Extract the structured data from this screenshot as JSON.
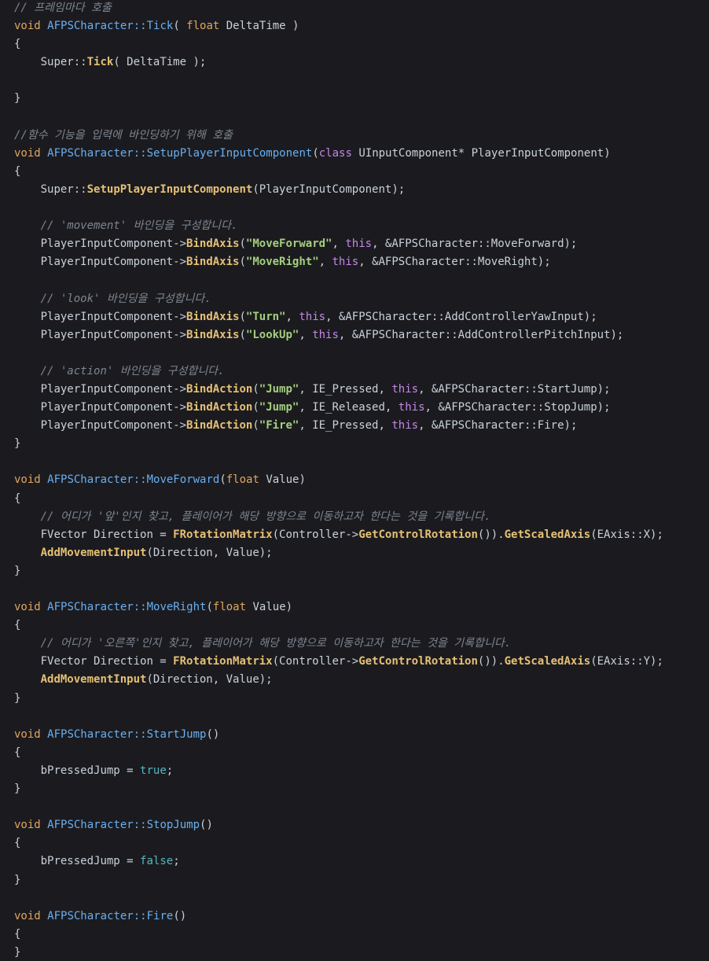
{
  "window": {
    "title": ""
  },
  "colors": {
    "background": "#1b1b1f",
    "comment": "#7d8590",
    "keyword": "#e2a55f",
    "function_def": "#69aff2",
    "function_call": "#e5c075",
    "string": "#a4cf7e",
    "this": "#c586e8",
    "literal": "#56b6c2",
    "text": "#c9d1d9"
  },
  "code": {
    "lines": [
      {
        "indent": 0,
        "tokens": [
          {
            "t": "comment",
            "v": "// 프레임마다 호출"
          }
        ]
      },
      {
        "indent": 0,
        "tokens": [
          {
            "t": "kw",
            "v": "void"
          },
          {
            "t": "plain",
            "v": " "
          },
          {
            "t": "fn",
            "v": "AFPSCharacter::Tick"
          },
          {
            "t": "plain",
            "v": "( "
          },
          {
            "t": "kw",
            "v": "float"
          },
          {
            "t": "plain",
            "v": " DeltaTime )"
          }
        ]
      },
      {
        "indent": 0,
        "tokens": [
          {
            "t": "plain",
            "v": "{"
          }
        ]
      },
      {
        "indent": 1,
        "tokens": [
          {
            "t": "plain",
            "v": "Super::"
          },
          {
            "t": "call",
            "v": "Tick"
          },
          {
            "t": "plain",
            "v": "( DeltaTime );"
          }
        ]
      },
      {
        "indent": 0,
        "tokens": []
      },
      {
        "indent": 0,
        "tokens": [
          {
            "t": "plain",
            "v": "}"
          }
        ]
      },
      {
        "indent": 0,
        "tokens": []
      },
      {
        "indent": 0,
        "tokens": [
          {
            "t": "comment",
            "v": "//함수 기능을 입력에 바인딩하기 위해 호출"
          }
        ]
      },
      {
        "indent": 0,
        "tokens": [
          {
            "t": "kw",
            "v": "void"
          },
          {
            "t": "plain",
            "v": " "
          },
          {
            "t": "fn",
            "v": "AFPSCharacter::SetupPlayerInputComponent"
          },
          {
            "t": "plain",
            "v": "("
          },
          {
            "t": "kw2",
            "v": "class"
          },
          {
            "t": "plain",
            "v": " UInputComponent* PlayerInputComponent)"
          }
        ]
      },
      {
        "indent": 0,
        "tokens": [
          {
            "t": "plain",
            "v": "{"
          }
        ]
      },
      {
        "indent": 1,
        "tokens": [
          {
            "t": "plain",
            "v": "Super::"
          },
          {
            "t": "call",
            "v": "SetupPlayerInputComponent"
          },
          {
            "t": "plain",
            "v": "(PlayerInputComponent);"
          }
        ]
      },
      {
        "indent": 0,
        "tokens": []
      },
      {
        "indent": 1,
        "tokens": [
          {
            "t": "comment",
            "v": "// 'movement' 바인딩을 구성합니다."
          }
        ]
      },
      {
        "indent": 1,
        "tokens": [
          {
            "t": "plain",
            "v": "PlayerInputComponent->"
          },
          {
            "t": "call",
            "v": "BindAxis"
          },
          {
            "t": "plain",
            "v": "("
          },
          {
            "t": "str",
            "v": "\"MoveForward\""
          },
          {
            "t": "plain",
            "v": ", "
          },
          {
            "t": "this",
            "v": "this"
          },
          {
            "t": "plain",
            "v": ", &AFPSCharacter::MoveForward);"
          }
        ]
      },
      {
        "indent": 1,
        "tokens": [
          {
            "t": "plain",
            "v": "PlayerInputComponent->"
          },
          {
            "t": "call",
            "v": "BindAxis"
          },
          {
            "t": "plain",
            "v": "("
          },
          {
            "t": "str",
            "v": "\"MoveRight\""
          },
          {
            "t": "plain",
            "v": ", "
          },
          {
            "t": "this",
            "v": "this"
          },
          {
            "t": "plain",
            "v": ", &AFPSCharacter::MoveRight);"
          }
        ]
      },
      {
        "indent": 0,
        "tokens": []
      },
      {
        "indent": 1,
        "tokens": [
          {
            "t": "comment",
            "v": "// 'look' 바인딩을 구성합니다."
          }
        ]
      },
      {
        "indent": 1,
        "tokens": [
          {
            "t": "plain",
            "v": "PlayerInputComponent->"
          },
          {
            "t": "call",
            "v": "BindAxis"
          },
          {
            "t": "plain",
            "v": "("
          },
          {
            "t": "str",
            "v": "\"Turn\""
          },
          {
            "t": "plain",
            "v": ", "
          },
          {
            "t": "this",
            "v": "this"
          },
          {
            "t": "plain",
            "v": ", &AFPSCharacter::AddControllerYawInput);"
          }
        ]
      },
      {
        "indent": 1,
        "tokens": [
          {
            "t": "plain",
            "v": "PlayerInputComponent->"
          },
          {
            "t": "call",
            "v": "BindAxis"
          },
          {
            "t": "plain",
            "v": "("
          },
          {
            "t": "str",
            "v": "\"LookUp\""
          },
          {
            "t": "plain",
            "v": ", "
          },
          {
            "t": "this",
            "v": "this"
          },
          {
            "t": "plain",
            "v": ", &AFPSCharacter::AddControllerPitchInput);"
          }
        ]
      },
      {
        "indent": 0,
        "tokens": []
      },
      {
        "indent": 1,
        "tokens": [
          {
            "t": "comment",
            "v": "// 'action' 바인딩을 구성합니다."
          }
        ]
      },
      {
        "indent": 1,
        "tokens": [
          {
            "t": "plain",
            "v": "PlayerInputComponent->"
          },
          {
            "t": "call",
            "v": "BindAction"
          },
          {
            "t": "plain",
            "v": "("
          },
          {
            "t": "str",
            "v": "\"Jump\""
          },
          {
            "t": "plain",
            "v": ", IE_Pressed, "
          },
          {
            "t": "this",
            "v": "this"
          },
          {
            "t": "plain",
            "v": ", &AFPSCharacter::StartJump);"
          }
        ]
      },
      {
        "indent": 1,
        "tokens": [
          {
            "t": "plain",
            "v": "PlayerInputComponent->"
          },
          {
            "t": "call",
            "v": "BindAction"
          },
          {
            "t": "plain",
            "v": "("
          },
          {
            "t": "str",
            "v": "\"Jump\""
          },
          {
            "t": "plain",
            "v": ", IE_Released, "
          },
          {
            "t": "this",
            "v": "this"
          },
          {
            "t": "plain",
            "v": ", &AFPSCharacter::StopJump);"
          }
        ]
      },
      {
        "indent": 1,
        "tokens": [
          {
            "t": "plain",
            "v": "PlayerInputComponent->"
          },
          {
            "t": "call",
            "v": "BindAction"
          },
          {
            "t": "plain",
            "v": "("
          },
          {
            "t": "str",
            "v": "\"Fire\""
          },
          {
            "t": "plain",
            "v": ", IE_Pressed, "
          },
          {
            "t": "this",
            "v": "this"
          },
          {
            "t": "plain",
            "v": ", &AFPSCharacter::Fire);"
          }
        ]
      },
      {
        "indent": 0,
        "tokens": [
          {
            "t": "plain",
            "v": "}"
          }
        ]
      },
      {
        "indent": 0,
        "tokens": []
      },
      {
        "indent": 0,
        "tokens": [
          {
            "t": "kw",
            "v": "void"
          },
          {
            "t": "plain",
            "v": " "
          },
          {
            "t": "fn",
            "v": "AFPSCharacter::MoveForward"
          },
          {
            "t": "plain",
            "v": "("
          },
          {
            "t": "kw",
            "v": "float"
          },
          {
            "t": "plain",
            "v": " Value)"
          }
        ]
      },
      {
        "indent": 0,
        "tokens": [
          {
            "t": "plain",
            "v": "{"
          }
        ]
      },
      {
        "indent": 1,
        "tokens": [
          {
            "t": "comment",
            "v": "// 어디가 '앞'인지 찾고, 플레이어가 해당 방향으로 이동하고자 한다는 것을 기록합니다."
          }
        ]
      },
      {
        "indent": 1,
        "tokens": [
          {
            "t": "plain",
            "v": "FVector Direction = "
          },
          {
            "t": "call",
            "v": "FRotationMatrix"
          },
          {
            "t": "plain",
            "v": "(Controller->"
          },
          {
            "t": "call",
            "v": "GetControlRotation"
          },
          {
            "t": "plain",
            "v": "())."
          },
          {
            "t": "call",
            "v": "GetScaledAxis"
          },
          {
            "t": "plain",
            "v": "(EAxis::X);"
          }
        ]
      },
      {
        "indent": 1,
        "tokens": [
          {
            "t": "call",
            "v": "AddMovementInput"
          },
          {
            "t": "plain",
            "v": "(Direction, Value);"
          }
        ]
      },
      {
        "indent": 0,
        "tokens": [
          {
            "t": "plain",
            "v": "}"
          }
        ]
      },
      {
        "indent": 0,
        "tokens": []
      },
      {
        "indent": 0,
        "tokens": [
          {
            "t": "kw",
            "v": "void"
          },
          {
            "t": "plain",
            "v": " "
          },
          {
            "t": "fn",
            "v": "AFPSCharacter::MoveRight"
          },
          {
            "t": "plain",
            "v": "("
          },
          {
            "t": "kw",
            "v": "float"
          },
          {
            "t": "plain",
            "v": " Value)"
          }
        ]
      },
      {
        "indent": 0,
        "tokens": [
          {
            "t": "plain",
            "v": "{"
          }
        ]
      },
      {
        "indent": 1,
        "tokens": [
          {
            "t": "comment",
            "v": "// 어디가 '오른쪽'인지 찾고, 플레이어가 해당 방향으로 이동하고자 한다는 것을 기록합니다."
          }
        ]
      },
      {
        "indent": 1,
        "tokens": [
          {
            "t": "plain",
            "v": "FVector Direction = "
          },
          {
            "t": "call",
            "v": "FRotationMatrix"
          },
          {
            "t": "plain",
            "v": "(Controller->"
          },
          {
            "t": "call",
            "v": "GetControlRotation"
          },
          {
            "t": "plain",
            "v": "())."
          },
          {
            "t": "call",
            "v": "GetScaledAxis"
          },
          {
            "t": "plain",
            "v": "(EAxis::Y);"
          }
        ]
      },
      {
        "indent": 1,
        "tokens": [
          {
            "t": "call",
            "v": "AddMovementInput"
          },
          {
            "t": "plain",
            "v": "(Direction, Value);"
          }
        ]
      },
      {
        "indent": 0,
        "tokens": [
          {
            "t": "plain",
            "v": "}"
          }
        ]
      },
      {
        "indent": 0,
        "tokens": []
      },
      {
        "indent": 0,
        "tokens": [
          {
            "t": "kw",
            "v": "void"
          },
          {
            "t": "plain",
            "v": " "
          },
          {
            "t": "fn",
            "v": "AFPSCharacter::StartJump"
          },
          {
            "t": "plain",
            "v": "()"
          }
        ]
      },
      {
        "indent": 0,
        "tokens": [
          {
            "t": "plain",
            "v": "{"
          }
        ]
      },
      {
        "indent": 1,
        "tokens": [
          {
            "t": "plain",
            "v": "bPressedJump = "
          },
          {
            "t": "lit",
            "v": "true"
          },
          {
            "t": "plain",
            "v": ";"
          }
        ]
      },
      {
        "indent": 0,
        "tokens": [
          {
            "t": "plain",
            "v": "}"
          }
        ]
      },
      {
        "indent": 0,
        "tokens": []
      },
      {
        "indent": 0,
        "tokens": [
          {
            "t": "kw",
            "v": "void"
          },
          {
            "t": "plain",
            "v": " "
          },
          {
            "t": "fn",
            "v": "AFPSCharacter::StopJump"
          },
          {
            "t": "plain",
            "v": "()"
          }
        ]
      },
      {
        "indent": 0,
        "tokens": [
          {
            "t": "plain",
            "v": "{"
          }
        ]
      },
      {
        "indent": 1,
        "tokens": [
          {
            "t": "plain",
            "v": "bPressedJump = "
          },
          {
            "t": "lit",
            "v": "false"
          },
          {
            "t": "plain",
            "v": ";"
          }
        ]
      },
      {
        "indent": 0,
        "tokens": [
          {
            "t": "plain",
            "v": "}"
          }
        ]
      },
      {
        "indent": 0,
        "tokens": []
      },
      {
        "indent": 0,
        "tokens": [
          {
            "t": "kw",
            "v": "void"
          },
          {
            "t": "plain",
            "v": " "
          },
          {
            "t": "fn",
            "v": "AFPSCharacter::Fire"
          },
          {
            "t": "plain",
            "v": "()"
          }
        ]
      },
      {
        "indent": 0,
        "tokens": [
          {
            "t": "plain",
            "v": "{"
          }
        ]
      },
      {
        "indent": 0,
        "tokens": [
          {
            "t": "plain",
            "v": "}"
          }
        ]
      }
    ]
  }
}
